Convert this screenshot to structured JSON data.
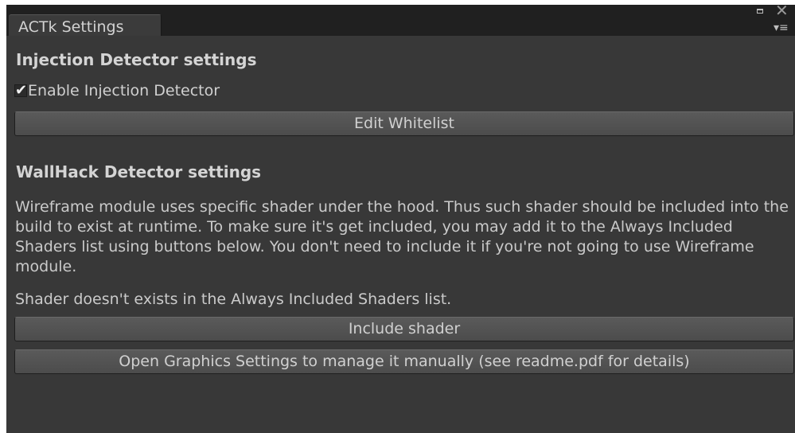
{
  "window": {
    "tab_title": "ACTk Settings",
    "icons": {
      "maximize": "maximize-icon",
      "close": "close-icon",
      "menu": "context-menu-icon"
    },
    "colors": {
      "background": "#383838",
      "titlebar": "#202020",
      "button": "#555555",
      "text": "#d0d0d0"
    }
  },
  "injection": {
    "heading": "Injection Detector settings",
    "enable_label": "Enable Injection Detector",
    "enable_checked": true,
    "edit_whitelist_label": "Edit Whitelist"
  },
  "wallhack": {
    "heading": "WallHack Detector settings",
    "description": "Wireframe module uses specific shader under the hood. Thus such shader should be included into the build to exist at runtime. To make sure it's get included, you may add it to the Always Included Shaders list using buttons below. You don't need to include it if you're not going to use Wireframe module.",
    "status": "Shader doesn't exists in the Always Included Shaders list.",
    "include_shader_label": "Include shader",
    "open_graphics_label": "Open Graphics Settings to manage it manually (see readme.pdf for details)"
  }
}
